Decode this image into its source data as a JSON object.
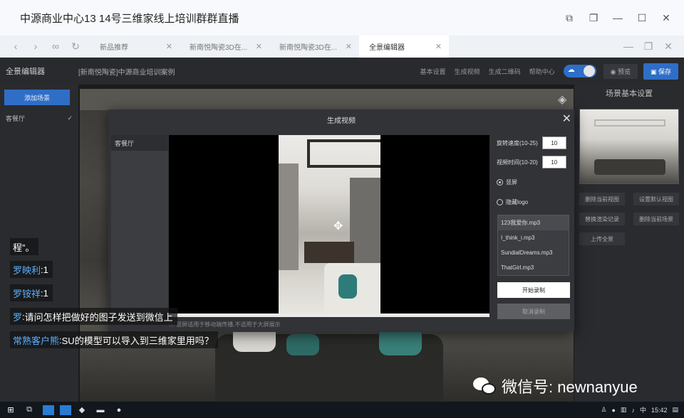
{
  "window": {
    "title": "中源商业中心13 14号三维家线上培训群群直播"
  },
  "tabs": [
    {
      "label": "新品推荐"
    },
    {
      "label": "新南悦陶瓷3D在..."
    },
    {
      "label": "新南悦陶瓷3D在..."
    },
    {
      "label": "全景编辑器"
    }
  ],
  "editor": {
    "app_name": "全景编辑器",
    "project_name": "[新南悦陶瓷]中源商业培训案例",
    "links": [
      "基本设置",
      "生成视频",
      "生成二维码",
      "帮助中心"
    ],
    "preview_label": "预览",
    "save_label": "保存"
  },
  "left_panel": {
    "add_scene_label": "添加场景",
    "scene_name": "客餐厅"
  },
  "right_panel": {
    "title": "场景基本设置",
    "buttons": [
      "删除当前视图",
      "设置默认视图",
      "替换渲染记录",
      "删除当前场景",
      "上传全景"
    ]
  },
  "modal": {
    "title": "生成视频",
    "scene_item": "客餐厅",
    "rotation_speed_label": "旋转速度(10-25)",
    "rotation_speed_value": "10",
    "video_duration_label": "视频时间(10-20)",
    "video_duration_value": "10",
    "portrait_label": "竖屏",
    "hide_logo_label": "隐藏logo",
    "music": [
      "123我爱你.mp3",
      "I_think_i.mp3",
      "SundialDreams.mp3",
      "ThatGirl.mp3"
    ],
    "start_label": "开始录制",
    "cancel_label": "取消录制",
    "note": "竖屏适用于移动端传播,不适用于大屏展示"
  },
  "chat": [
    {
      "name": "",
      "sep": "",
      "text": "程”。"
    },
    {
      "name": "罗映利",
      "sep": " : ",
      "text": "1"
    },
    {
      "name": "罗铵祥",
      "sep": " : ",
      "text": "1"
    },
    {
      "name": "罗",
      "sep": " : ",
      "text": "请问怎样把做好的图子发送到微信上"
    },
    {
      "name": "常熟客户熊",
      "sep": " : ",
      "text": "SU的模型可以导入到三维家里用吗？"
    }
  ],
  "watermark": {
    "text": "微信号: newnanyue"
  },
  "taskbar": {
    "ime": "中",
    "time": "15:42"
  }
}
